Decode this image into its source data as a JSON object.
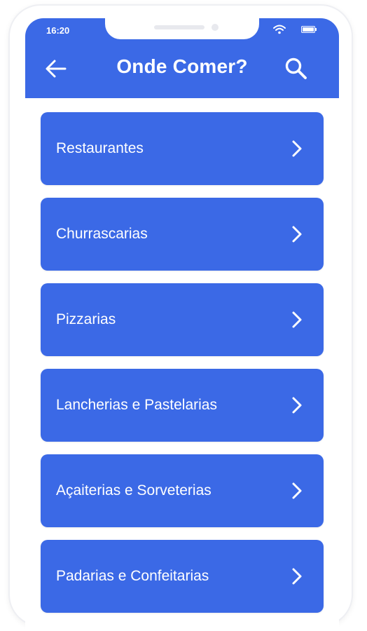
{
  "status_bar": {
    "time": "16:20",
    "wifi_icon": "wifi-icon",
    "battery_icon": "battery-icon"
  },
  "header": {
    "title": "Onde Comer?",
    "back_icon": "arrow-left-icon",
    "search_icon": "search-icon"
  },
  "categories": [
    {
      "label": "Restaurantes",
      "icon": "chevron-right-icon"
    },
    {
      "label": "Churrascarias",
      "icon": "chevron-right-icon"
    },
    {
      "label": "Pizzarias",
      "icon": "chevron-right-icon"
    },
    {
      "label": "Lancherias e Pastelarias",
      "icon": "chevron-right-icon"
    },
    {
      "label": "Açaiterias e Sorveterias",
      "icon": "chevron-right-icon"
    },
    {
      "label": "Padarias e Confeitarias",
      "icon": "chevron-right-icon"
    }
  ],
  "colors": {
    "primary": "#3b69e6",
    "text_on_primary": "#ffffff",
    "background": "#ffffff"
  }
}
